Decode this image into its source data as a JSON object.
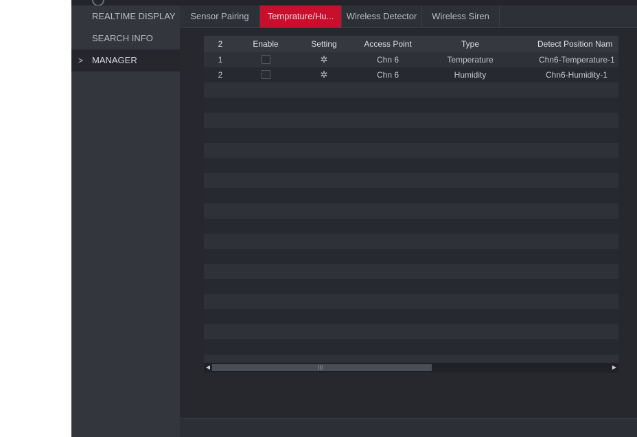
{
  "sidebar": {
    "items": [
      {
        "label": "REALTIME DISPLAY"
      },
      {
        "label": "SEARCH INFO"
      },
      {
        "label": "MANAGER",
        "marker": ">"
      }
    ]
  },
  "tabs": [
    {
      "label": "Sensor Pairing"
    },
    {
      "label": "Temprature/Hu..."
    },
    {
      "label": "Wireless Detector"
    },
    {
      "label": "Wireless Siren"
    }
  ],
  "table": {
    "headers": [
      "2",
      "Enable",
      "Setting",
      "Access Point",
      "Type",
      "Detect Position Nam"
    ],
    "rows": [
      {
        "index": "1",
        "access_point": "Chn 6",
        "type": "Temperature",
        "position": "Chn6-Temperature-1"
      },
      {
        "index": "2",
        "access_point": "Chn 6",
        "type": "Humidity",
        "position": "Chn6-Humidity-1"
      }
    ]
  },
  "scrollbar": {
    "grip": "III",
    "left_arrow": "◀",
    "right_arrow": "▶"
  },
  "icons": {
    "settings": "gear-icon",
    "chevron": "chevron-right-icon"
  },
  "colors": {
    "accent": "#c8102e",
    "background": "#2a2c33"
  }
}
